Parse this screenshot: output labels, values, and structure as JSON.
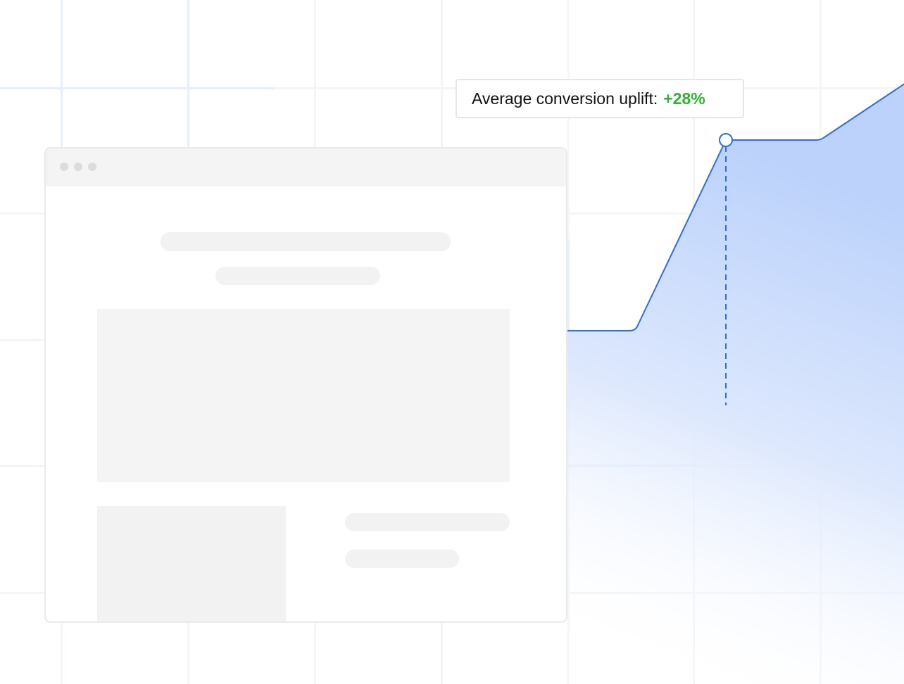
{
  "uplift": {
    "label": "Average conversion uplift:",
    "value": "+28%",
    "value_color": "#2db52d"
  },
  "chart_data": {
    "type": "area",
    "x": [
      0,
      1,
      2,
      3,
      4
    ],
    "y": [
      1.0,
      1.0,
      1.28,
      1.28,
      1.38
    ],
    "highlight_index": 2,
    "line_color": "#2a6ee8",
    "fill_color": "#bcd2fb",
    "grid": true
  },
  "browser_window": {
    "titlebar_color": "#f4f4f4",
    "dots": 3
  }
}
